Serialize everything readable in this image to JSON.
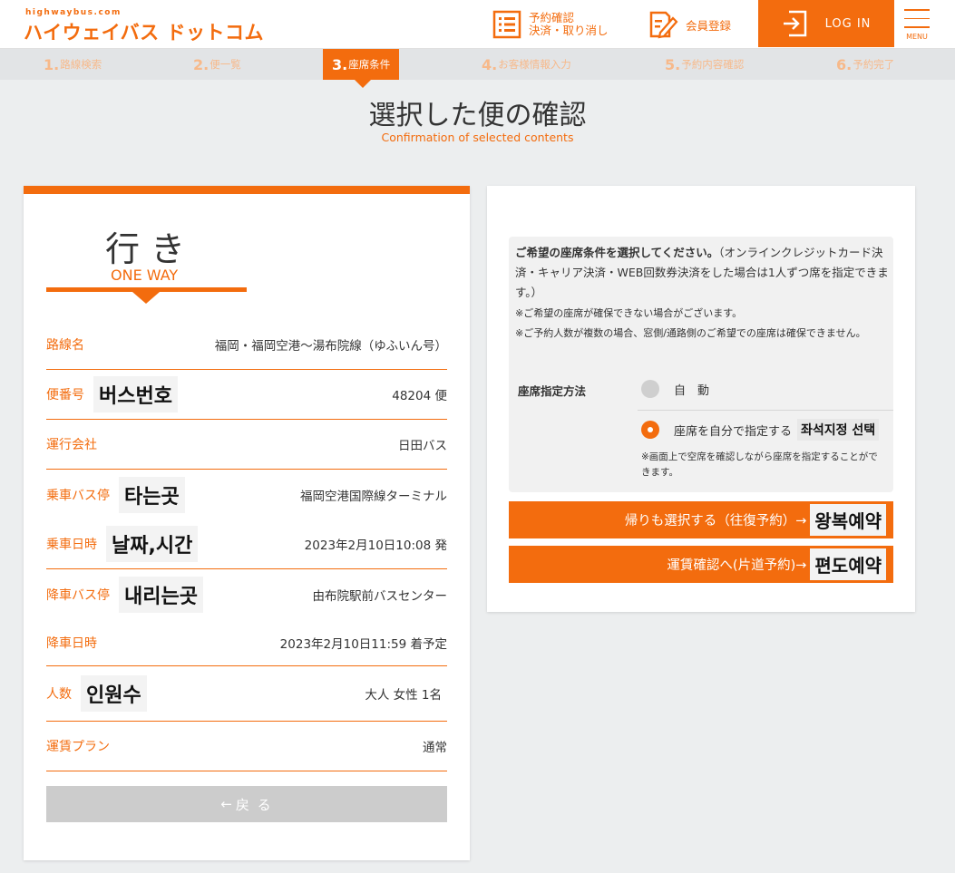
{
  "header": {
    "logo_small": "highwaybus.com",
    "logo_main": "ハイウェイバス ドットコム",
    "reserve_line1": "予約確認",
    "reserve_line2": "決済・取り消し",
    "member_label": "会員登録",
    "login_label": "LOG IN",
    "menu_label": "MENU"
  },
  "steps": [
    {
      "num": "1.",
      "label": "路線検索"
    },
    {
      "num": "2.",
      "label": "便一覧"
    },
    {
      "num": "3.",
      "label": "座席条件"
    },
    {
      "num": "4.",
      "label": "お客様情報入力"
    },
    {
      "num": "5.",
      "label": "予約内容確認"
    },
    {
      "num": "6.",
      "label": "予約完了"
    }
  ],
  "title": "選択した便の確認",
  "subtitle": "Confirmation of selected contents",
  "trip": {
    "heading_jp": "行き",
    "heading_en": "ONE WAY",
    "route_label": "路線名",
    "route_value": "福岡・福岡空港〜湯布院線（ゆふいん号）",
    "bus_no_label": "便番号",
    "bus_no_badge": "버스번호",
    "bus_no_value": "48204 便",
    "company_label": "運行会社",
    "company_value": "日田バス",
    "board_stop_label": "乗車バス停",
    "board_stop_badge": "타는곳",
    "board_stop_value": "福岡空港国際線ターミナル",
    "board_time_label": "乗車日時",
    "board_time_badge": "날짜,시간",
    "board_time_value": "2023年2月10日10:08 発",
    "alight_stop_label": "降車バス停",
    "alight_stop_badge": "내리는곳",
    "alight_stop_value": "由布院駅前バスセンター",
    "alight_time_label": "降車日時",
    "alight_time_value": "2023年2月10日11:59 着予定",
    "people_label": "人数",
    "people_badge": "인원수",
    "people_value": "大人 女性 1名",
    "plan_label": "運賃プラン",
    "plan_value": "通常",
    "back_label": "戻 る"
  },
  "seat": {
    "lead_bold": "ご希望の座席条件を選択してください。",
    "lead_rest": "（オンラインクレジットカード決済・キャリア決済・WEB回数券決済をした場合は1人ずつ席を指定できます。）",
    "note1": "※ご希望の座席が確保できない場合がございます。",
    "note2": "※ご予約人数が複数の場合、窓側/通路側のご希望での座席は確保できません。",
    "method_label": "座席指定方法",
    "option_auto": "自　動",
    "option_manual": "座席を自分で指定する",
    "option_manual_badge": "좌석지정 선택",
    "manual_note": "※画面上で空席を確認しながら座席を指定することができます。",
    "selected": "manual"
  },
  "actions": {
    "roundtrip_label": "帰りも選択する（往復予約）→",
    "roundtrip_badge": "왕복예약",
    "oneway_label": "運賃確認へ(片道予約)→",
    "oneway_badge": "편도예약"
  },
  "colors": {
    "accent": "#f36c0e",
    "background": "#eceeef"
  }
}
